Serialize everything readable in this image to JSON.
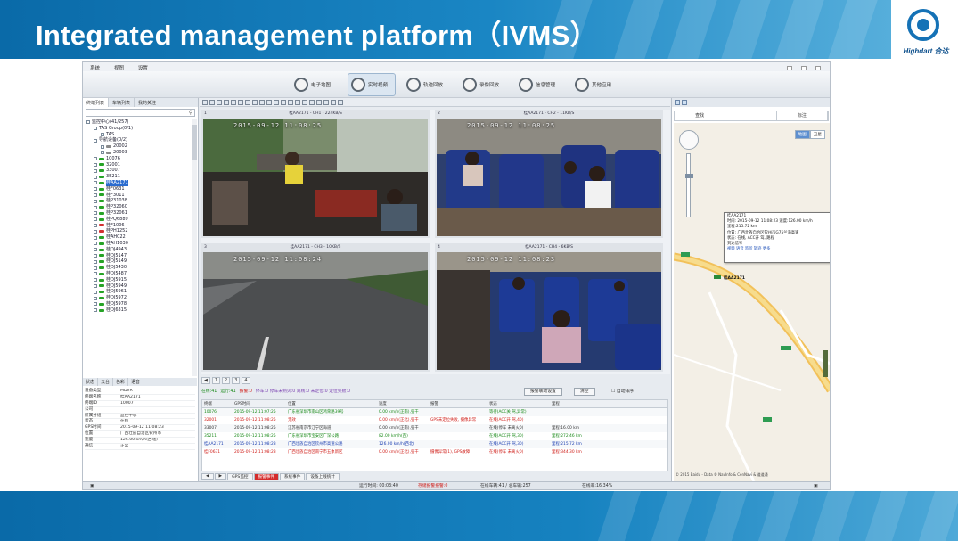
{
  "slide": {
    "title": "Integrated management platform（IVMS）",
    "logo_text": "Highdart 合达"
  },
  "colors": {
    "banner": "#1180c0",
    "accent": "#1572b6",
    "alarm": "#d42c2c",
    "online": "#1a8a1a"
  },
  "app": {
    "menu": [
      "系统",
      "视图",
      "设置"
    ],
    "toolbar": [
      {
        "label": "电子地图",
        "icon": "map-icon",
        "active": false
      },
      {
        "label": "实时视频",
        "icon": "video-icon",
        "active": true
      },
      {
        "label": "轨迹回放",
        "icon": "track-icon",
        "active": false
      },
      {
        "label": "录像回放",
        "icon": "playback-icon",
        "active": false
      },
      {
        "label": "信息管理",
        "icon": "info-icon",
        "active": false
      },
      {
        "label": "其他应用",
        "icon": "apps-icon",
        "active": false
      }
    ],
    "left_tabs": [
      "终端列表",
      "车辆列表",
      "我的关注"
    ],
    "tree": [
      {
        "t": "监控中心(41/257)",
        "lvl": 0,
        "c": ""
      },
      {
        "t": "TAS Group(0/1)",
        "lvl": 1,
        "c": ""
      },
      {
        "t": "TAS",
        "lvl": 2,
        "c": ""
      },
      {
        "t": "导航设备(0/2)",
        "lvl": 1,
        "c": ""
      },
      {
        "t": "20002",
        "lvl": 2,
        "c": "#8a8a8a"
      },
      {
        "t": "20003",
        "lvl": 2,
        "c": "#8a8a8a"
      },
      {
        "t": "10076",
        "lvl": 1,
        "c": "#26a326"
      },
      {
        "t": "32001",
        "lvl": 1,
        "c": "#26a326"
      },
      {
        "t": "33007",
        "lvl": 1,
        "c": "#26a326"
      },
      {
        "t": "35211",
        "lvl": 1,
        "c": "#26a326"
      },
      {
        "t": "桂AA2171",
        "lvl": 1,
        "c": "#26a326",
        "sel": true
      },
      {
        "t": "桂F0631",
        "lvl": 1,
        "c": "#26a326"
      },
      {
        "t": "桂F3011",
        "lvl": 1,
        "c": "#26a326"
      },
      {
        "t": "桂P31038",
        "lvl": 1,
        "c": "#26a326"
      },
      {
        "t": "桂P32060",
        "lvl": 1,
        "c": "#26a326"
      },
      {
        "t": "桂P32061",
        "lvl": 1,
        "c": "#26a326"
      },
      {
        "t": "桂PQ6889",
        "lvl": 1,
        "c": "#26a326"
      },
      {
        "t": "桂F1006",
        "lvl": 1,
        "c": "#d23030"
      },
      {
        "t": "桂PH1252",
        "lvl": 1,
        "c": "#d23030"
      },
      {
        "t": "桂AH022",
        "lvl": 1,
        "c": "#26a326"
      },
      {
        "t": "桂AH1030",
        "lvl": 1,
        "c": "#26a326"
      },
      {
        "t": "桂DJ4943",
        "lvl": 1,
        "c": "#26a326"
      },
      {
        "t": "桂DJ5147",
        "lvl": 1,
        "c": "#26a326"
      },
      {
        "t": "桂DJ5149",
        "lvl": 1,
        "c": "#26a326"
      },
      {
        "t": "桂DJ5430",
        "lvl": 1,
        "c": "#26a326"
      },
      {
        "t": "桂DJ5487",
        "lvl": 1,
        "c": "#26a326"
      },
      {
        "t": "桂DJ5915",
        "lvl": 1,
        "c": "#26a326"
      },
      {
        "t": "桂DJ5949",
        "lvl": 1,
        "c": "#26a326"
      },
      {
        "t": "桂DJ5961",
        "lvl": 1,
        "c": "#26a326"
      },
      {
        "t": "桂DJ5972",
        "lvl": 1,
        "c": "#26a326"
      },
      {
        "t": "桂DJ5978",
        "lvl": 1,
        "c": "#26a326"
      },
      {
        "t": "桂DJ6315",
        "lvl": 1,
        "c": "#26a326"
      }
    ],
    "info_tabs": [
      "状态",
      "云台",
      "色彩",
      "语音"
    ],
    "info": [
      {
        "k": "设备类型",
        "v": "MDVR"
      },
      {
        "k": "终端名称",
        "v": "桂AA2171"
      },
      {
        "k": "终端ID",
        "v": "10007"
      },
      {
        "k": "公司",
        "v": ""
      },
      {
        "k": "所属分组",
        "v": "监控中心"
      },
      {
        "k": "状态",
        "v": "在线"
      },
      {
        "k": "GPS时间",
        "v": "2015-09-12 11:08:23"
      },
      {
        "k": "位置",
        "v": "广西壮族自治区钦州市"
      },
      {
        "k": "速度",
        "v": "126.00 km/h(西北)"
      },
      {
        "k": "通信",
        "v": "正常"
      }
    ],
    "videos": [
      {
        "num": "1",
        "title": "桂AA2171 - CH1 - 224KB/S",
        "stamp": "2015-09-12 11:08:25"
      },
      {
        "num": "2",
        "title": "桂AA2171 - CH2 - 11KB/S",
        "stamp": "2015-09-12 11:08:25"
      },
      {
        "num": "3",
        "title": "桂AA2171 - CH3 - 10KB/S",
        "stamp": "2015-09-12 11:08:24"
      },
      {
        "num": "4",
        "title": "桂AA2171 - CH4 - 6KB/S",
        "stamp": "2015-09-12 11:08:23"
      }
    ],
    "pages": [
      "1",
      "2",
      "3",
      "4"
    ],
    "summary": {
      "online": "在线:41",
      "run": "运行:41",
      "alarm": "报警:0",
      "text": "停车:0 停车未熟火:0 离线:0 未定位:0 定位失败:0",
      "set_button": "报警联动设置",
      "clear_button": "清空",
      "auto_sort": "自动排序"
    },
    "gps_headers": [
      "终端",
      "GPS时间",
      "位置",
      "速度",
      "报警",
      "状态",
      "里程"
    ],
    "gps_rows": [
      {
        "cls": "green",
        "cells": [
          "10076",
          "2015-09-12 11:07:25",
          "广东省深圳市南山区鸿荣路39号",
          "0.00 km/h(正南),强干",
          "",
          "等待(ACC关 驾,异常)",
          ""
        ]
      },
      {
        "cls": "red",
        "cells": [
          "32001",
          "2015-09-12 11:08:25",
          "无效",
          "0.00 km/h(正北),强干",
          "GPS未定位失败, 摄像异常",
          "在线(ACC开 驾,40)",
          ""
        ]
      },
      {
        "cls": "dark",
        "cells": [
          "33007",
          "2015-09-12 11:08:25",
          "江苏省南京市江宁区海道",
          "0.00 km/h(正南),强干",
          "",
          "在线(停车 未离火0)",
          "里程:16.00 km"
        ]
      },
      {
        "cls": "green",
        "cells": [
          "35211",
          "2015-09-12 11:08:25",
          "广东省深圳市宝安区广深公路",
          "82.00 km/h(西)",
          "",
          "在线(ACC开 驾,30)",
          "里程:272.46 km"
        ]
      },
      {
        "cls": "blue",
        "cells": [
          "桂AA2171",
          "2015-09-12 11:08:23",
          "广西壮族自治区钦州市高速公路",
          "126.00 km/h(西北)",
          "",
          "在线(ACC开 驾,30)",
          "里程:215.72 km"
        ]
      },
      {
        "cls": "red",
        "cells": [
          "桂F0631",
          "2015-09-12 11:08:23",
          "广西壮族自治区南宁市五象新区",
          "0.00 km/h(正北),强干",
          "摄像异常(1), GPS故障",
          "在线(停车 未离火0)",
          "里程:344.30 km"
        ]
      }
    ],
    "bottom_tabs": [
      "GPS监控",
      "报警事件",
      "系统事件",
      "设备上线统计"
    ],
    "right": {
      "search_tabs": [
        "查找",
        "",
        "标注"
      ],
      "map_types": [
        "地图",
        "卫星"
      ],
      "popup": [
        "桂AA2171",
        "时间: 2015-09-12 11:08:23  速度:126.00 km/h",
        "里程:215.72 km",
        "位置: 广西壮族自治区钦州市G75兰海高速",
        "状态: 在线, ACC开 驾, 路程",
        "到达信号"
      ],
      "popup_links": "视频  语音  监听  轨迹  更多",
      "car_label": "桂AA2171",
      "copyright": "© 2015 Baidu - Data © NavInfo & CenNavi & 道道通"
    },
    "statusbar": {
      "runtime": "运行时间: 00:03:40",
      "alarm": "存储报警报警:0",
      "stats": "在线车辆:41 / 总车辆:257",
      "rate": "在线率:16.34%"
    }
  }
}
